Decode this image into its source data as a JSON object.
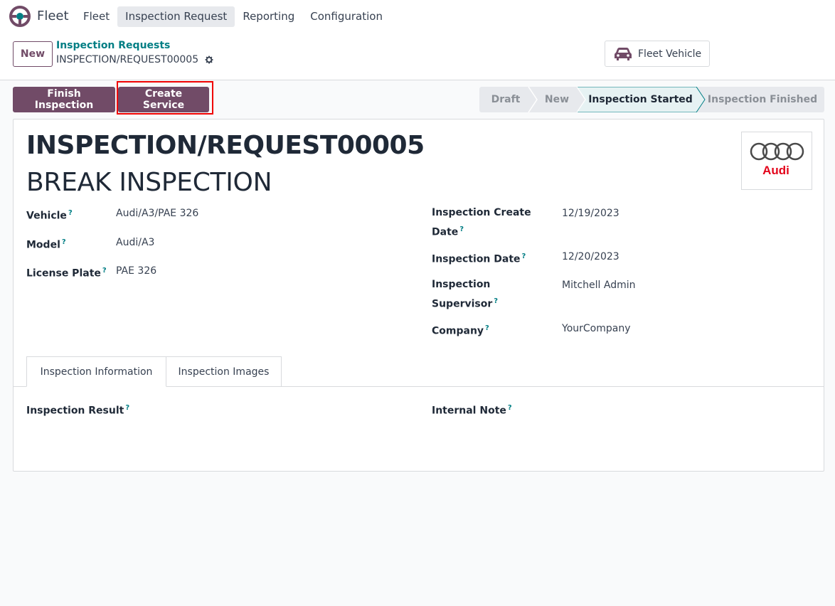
{
  "app": {
    "name": "Fleet"
  },
  "menu": [
    {
      "label": "Fleet"
    },
    {
      "label": "Inspection Request"
    },
    {
      "label": "Reporting"
    },
    {
      "label": "Configuration"
    }
  ],
  "control_panel": {
    "new_label": "New",
    "breadcrumb_parent": "Inspection Requests",
    "breadcrumb_current": "INSPECTION/REQUEST00005",
    "smart_button_label": "Fleet Vehicle"
  },
  "actions": {
    "finish_label": "Finish Inspection",
    "create_service_label": "Create Service"
  },
  "status": {
    "stages": [
      "Draft",
      "New",
      "Inspection Started",
      "Inspection Finished"
    ],
    "current": "Inspection Started"
  },
  "record": {
    "reference": "INSPECTION/REQUEST00005",
    "name": "BREAK INSPECTION",
    "image_brand": "Audi"
  },
  "fields_left": [
    {
      "label": "Vehicle",
      "value": "Audi/A3/PAE 326"
    },
    {
      "label": "Model",
      "value": "Audi/A3"
    },
    {
      "label": "License Plate",
      "value": "PAE 326"
    }
  ],
  "fields_right": [
    {
      "label_line1": "Inspection Create",
      "label_line2": "Date",
      "value": "12/19/2023"
    },
    {
      "label_line1": "Inspection Date",
      "value": "12/20/2023"
    },
    {
      "label_line1": "Inspection",
      "label_line2": "Supervisor",
      "value": "Mitchell Admin"
    },
    {
      "label_line1": "Company",
      "value": "YourCompany"
    }
  ],
  "help_mark": "?",
  "tabs": [
    {
      "label": "Inspection Information"
    },
    {
      "label": "Inspection Images"
    }
  ],
  "tab_fields": {
    "result_label": "Inspection Result",
    "note_label": "Internal Note"
  },
  "colors": {
    "primary": "#714b67",
    "link": "#017e84",
    "highlight": "#ef0000",
    "current_stage_bg": "#e6f2f3"
  }
}
